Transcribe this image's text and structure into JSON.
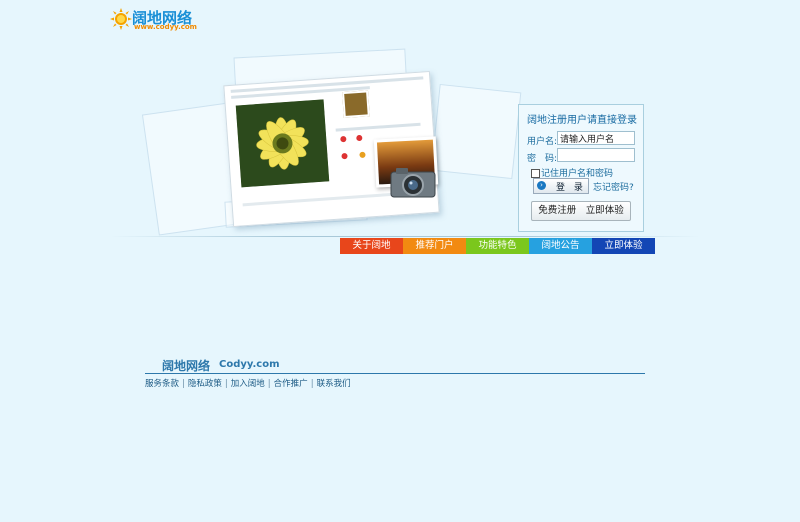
{
  "header": {
    "logo_title": "阔地网络",
    "logo_subtitle": "www.codyy.com"
  },
  "login": {
    "title": "阔地注册用户请直接登录",
    "username_label": "用户名:",
    "username_value": "请输入用户名",
    "password_label": "密　码:",
    "password_value": "",
    "remember_label": "记住用户名和密码",
    "login_button": "登 录",
    "forgot_link": "忘记密码?",
    "register_button": "免费注册　立即体验"
  },
  "nav": {
    "items": [
      {
        "label": "关于阔地",
        "color": "#e8461b"
      },
      {
        "label": "推荐门户",
        "color": "#f28a11"
      },
      {
        "label": "功能特色",
        "color": "#7bc71d"
      },
      {
        "label": "阔地公告",
        "color": "#26a1e0"
      },
      {
        "label": "立即体验",
        "color": "#1346b5"
      }
    ]
  },
  "footer": {
    "logo": "阔地网络",
    "domain": "Codyy.com",
    "links": [
      "服务条款",
      "隐私政策",
      "加入阔地",
      "合作推广",
      "联系我们"
    ]
  }
}
